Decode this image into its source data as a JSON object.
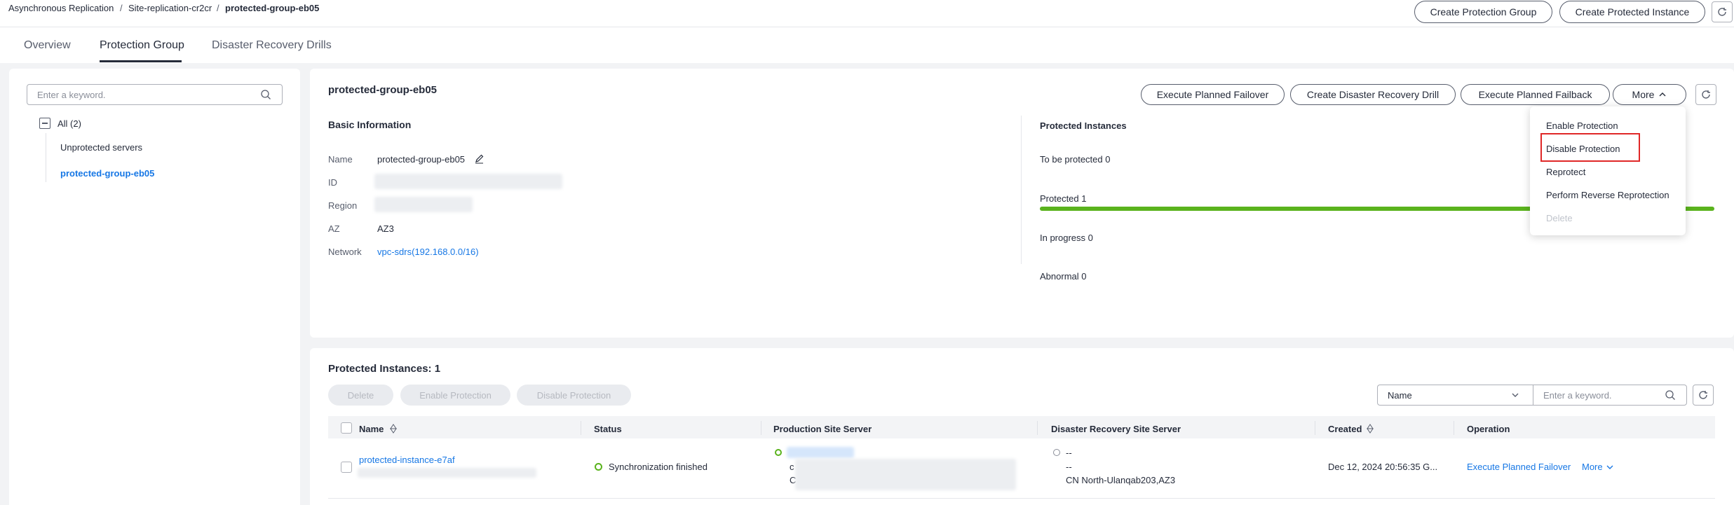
{
  "breadcrumb": {
    "items": [
      "Asynchronous Replication",
      "Site-replication-cr2cr",
      "protected-group-eb05"
    ],
    "separator": "/"
  },
  "header_actions": {
    "create_group": "Create Protection Group",
    "create_instance": "Create Protected Instance"
  },
  "tabs": [
    "Overview",
    "Protection Group",
    "Disaster Recovery Drills"
  ],
  "sidebar": {
    "search_placeholder": "Enter a keyword.",
    "all_label": "All (2)",
    "items": [
      "Unprotected servers",
      "protected-group-eb05"
    ]
  },
  "group": {
    "title": "protected-group-eb05",
    "actions": {
      "failover": "Execute Planned Failover",
      "drill": "Create Disaster Recovery Drill",
      "failback": "Execute Planned Failback",
      "more": "More"
    },
    "basic_info": {
      "heading": "Basic Information",
      "name_label": "Name",
      "name_value": "protected-group-eb05",
      "id_label": "ID",
      "region_label": "Region",
      "az_label": "AZ",
      "az_value": "AZ3",
      "network_label": "Network",
      "network_value": "vpc-sdrs(192.168.0.0/16)"
    },
    "protected_instances": {
      "heading": "Protected Instances",
      "to_be_protected": "To be protected 0",
      "protected": "Protected 1",
      "protected_fraction": 1.0,
      "in_progress": "In progress 0",
      "abnormal": "Abnormal 0"
    }
  },
  "more_menu": {
    "items": [
      "Enable Protection",
      "Disable Protection",
      "Reprotect",
      "Perform Reverse Reprotection",
      "Delete"
    ],
    "highlighted": "Disable Protection",
    "disabled": [
      "Delete"
    ]
  },
  "instances_table": {
    "title": "Protected Instances: 1",
    "batch_actions": [
      "Delete",
      "Enable Protection",
      "Disable Protection"
    ],
    "filter_select": "Name",
    "filter_placeholder": "Enter a keyword.",
    "columns": [
      "Name",
      "Status",
      "Production Site Server",
      "Disaster Recovery Site Server",
      "Created",
      "Operation"
    ],
    "rows": [
      {
        "name": "protected-instance-e7af",
        "status": "Synchronization finished",
        "prod_line2": "c",
        "prod_line3": "C",
        "dr_line1": "--",
        "dr_line2": "--",
        "dr_line3": "CN North-Ulanqab203,AZ3",
        "created": "Dec 12, 2024 20:56:35 G...",
        "op_primary": "Execute Planned Failover",
        "op_more": "More"
      }
    ]
  },
  "colors": {
    "accent_link": "#1677e5",
    "success_green": "#5ab31d",
    "highlight_red": "#e02828"
  }
}
